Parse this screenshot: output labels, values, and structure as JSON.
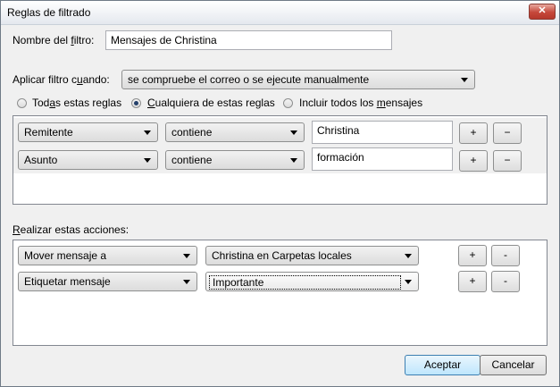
{
  "window": {
    "title": "Reglas de filtrado",
    "close_glyph": "✕"
  },
  "filter_name": {
    "label": "Nombre del filtro:",
    "value": "Mensajes de Christina"
  },
  "apply_when": {
    "label": "Aplicar filtro cuando:",
    "value": "se compruebe el correo o se ejecute manualmente"
  },
  "match": {
    "options": [
      "Todas estas reglas",
      "Cualquiera de estas reglas",
      "Incluir todos los mensajes"
    ],
    "selected": 1
  },
  "rules": [
    {
      "field": "Remitente",
      "operator": "contiene",
      "value": "Christina",
      "add": "+",
      "remove": "−"
    },
    {
      "field": "Asunto",
      "operator": "contiene",
      "value": "formación",
      "add": "+",
      "remove": "−"
    }
  ],
  "actions_label": "Realizar estas acciones:",
  "actions": [
    {
      "action": "Mover mensaje a",
      "target": "Christina en Carpetas locales",
      "add": "+",
      "remove": "-"
    },
    {
      "action": "Etiquetar mensaje",
      "target": "Importante",
      "add": "+",
      "remove": "-"
    }
  ],
  "buttons": {
    "accept": "Aceptar",
    "cancel": "Cancelar"
  },
  "icons": {
    "dropdown": "chevron-down-icon",
    "close": "close-icon"
  }
}
